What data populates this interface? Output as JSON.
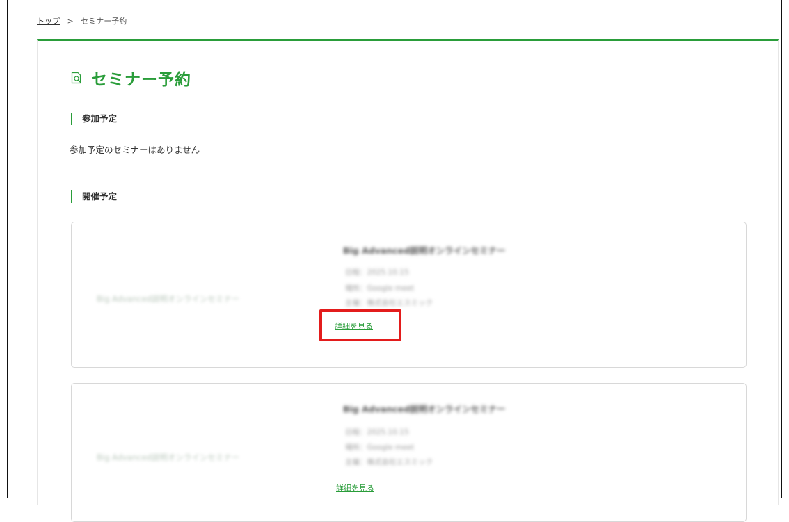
{
  "breadcrumb": {
    "home": "トップ",
    "separator": ">",
    "current": "セミナー予約"
  },
  "page": {
    "title": "セミナー予約",
    "icon": "document-search-icon"
  },
  "sections": {
    "upcoming_attending": {
      "heading": "参加予定",
      "empty_message": "参加予定のセミナーはありません"
    },
    "scheduled": {
      "heading": "開催予定"
    }
  },
  "cards": [
    {
      "image_alt": "Big Advanced説明オンラインセミナー",
      "title": "Big Advanced説明オンラインセミナー",
      "meta": [
        "日程：2025.10.15",
        "場所：Google meet",
        "主催：株式会社エスミック"
      ],
      "detail_link": "詳細を見る"
    },
    {
      "image_alt": "Big Advanced説明オンラインセミナー",
      "title": "Big Advanced説明オンラインセミナー",
      "meta": [
        "日程：2025.10.15",
        "場所：Google meet",
        "主催：株式会社エスミック"
      ],
      "detail_link": "詳細を見る"
    }
  ],
  "colors": {
    "accent": "#2a9d3a",
    "highlight": "#e31c1c"
  }
}
